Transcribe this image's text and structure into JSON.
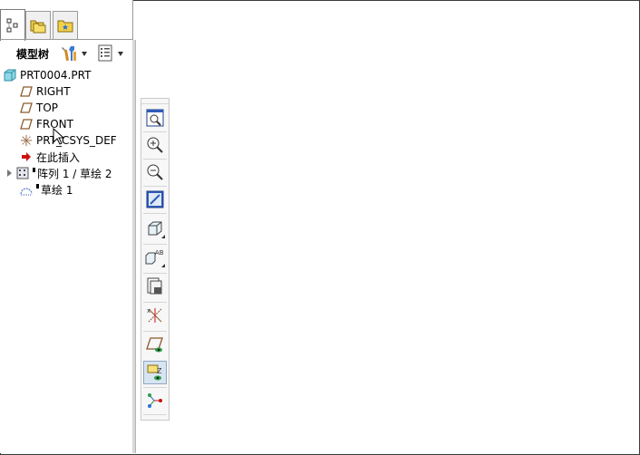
{
  "tabs": [
    {
      "name": "model-tree-tab",
      "icon": "tree-icon",
      "active": true
    },
    {
      "name": "folders-tab",
      "icon": "folders-icon",
      "active": false
    },
    {
      "name": "favorites-tab",
      "icon": "favorites-folder-icon",
      "active": false
    }
  ],
  "model_tree": {
    "title": "模型树",
    "settings_icon": "tools-icon",
    "show_icon": "list-icon"
  },
  "tree_items": [
    {
      "label": "PRT0004.PRT",
      "icon": "part-icon"
    },
    {
      "label": "RIGHT",
      "icon": "datum-plane-icon"
    },
    {
      "label": "TOP",
      "icon": "datum-plane-icon"
    },
    {
      "label": "FRONT",
      "icon": "datum-plane-icon"
    },
    {
      "label": "PRT_CSYS_DEF",
      "icon": "coordinate-system-icon"
    },
    {
      "label": "在此插入",
      "icon": "insert-here-arrow-icon"
    },
    {
      "label": "阵列 1 / 草绘 2",
      "icon": "pattern-icon"
    },
    {
      "label": "草绘 1",
      "icon": "sketch-icon"
    }
  ],
  "toolbar": [
    {
      "name": "refit-button",
      "icon": "zoom-fit-icon"
    },
    {
      "name": "zoom-in-button",
      "icon": "zoom-in-icon"
    },
    {
      "name": "zoom-out-button",
      "icon": "zoom-out-icon"
    },
    {
      "name": "repaint-button",
      "icon": "repaint-icon"
    },
    {
      "name": "view-orientation-button",
      "icon": "cube-view-icon"
    },
    {
      "name": "saved-views-button",
      "icon": "named-views-icon"
    },
    {
      "name": "layers-button",
      "icon": "layers-icon"
    },
    {
      "name": "csys-display-button",
      "icon": "csys-display-icon"
    },
    {
      "name": "plane-display-button",
      "icon": "plane-display-icon"
    },
    {
      "name": "annotation-display-button",
      "icon": "annotation-display-icon"
    },
    {
      "name": "spin-center-button",
      "icon": "spin-center-icon"
    }
  ],
  "colors": {
    "accent_selected": "#d7e4f2",
    "insert_arrow": "#cc1010",
    "datum_plane": "#8b5a2b",
    "part_cyan": "#3fb7c9"
  }
}
